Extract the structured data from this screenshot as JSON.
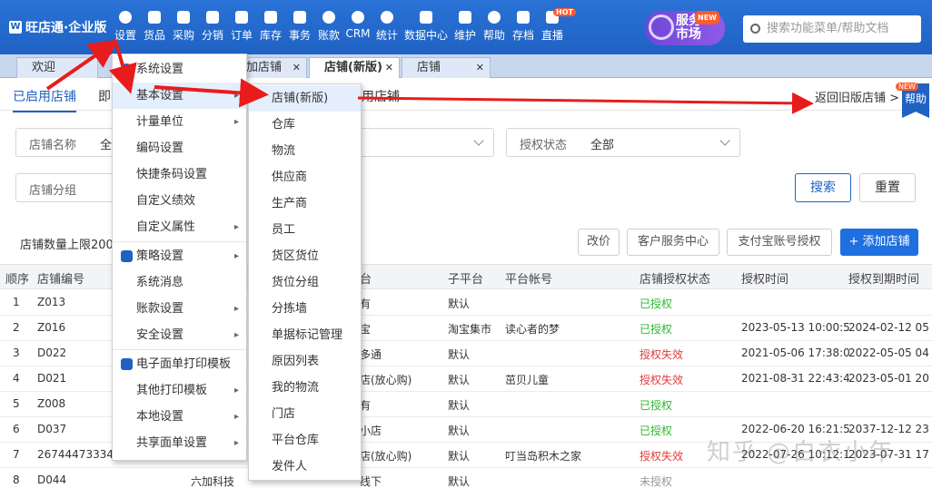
{
  "app": {
    "logo": "旺店通·企业版"
  },
  "nav": [
    {
      "label": "设置"
    },
    {
      "label": "货品"
    },
    {
      "label": "采购"
    },
    {
      "label": "分销"
    },
    {
      "label": "订单"
    },
    {
      "label": "库存"
    },
    {
      "label": "事务"
    },
    {
      "label": "账款"
    },
    {
      "label": "CRM"
    },
    {
      "label": "统计"
    },
    {
      "label": "数据中心"
    },
    {
      "label": "维护"
    },
    {
      "label": "帮助"
    },
    {
      "label": "存档"
    },
    {
      "label": "直播",
      "badge": "HOT"
    }
  ],
  "service_market": {
    "line1": "服务",
    "line2": "市场",
    "badge": "NEW"
  },
  "search": {
    "placeholder": "搜索功能菜单/帮助文档"
  },
  "tabs": [
    {
      "label": "欢迎"
    },
    {
      "label": "加店铺"
    },
    {
      "label": "店铺(新版)"
    },
    {
      "label": "店铺"
    }
  ],
  "subtabs": {
    "enabled": "已启用店铺",
    "partial": "即",
    "disabled_suffix": "用店铺",
    "back": "返回旧版店铺",
    "help": "帮助",
    "help_badge": "NEW"
  },
  "filters": {
    "shop_name_label": "店铺名称",
    "shop_name_value": "全",
    "auth_label": "授权状态",
    "auth_value": "全部",
    "group_label": "店铺分组",
    "search_btn": "搜索",
    "reset_btn": "重置"
  },
  "quota": "店铺数量上限200",
  "actions": {
    "price": "改价",
    "service": "客户服务中心",
    "alipay": "支付宝账号授权",
    "add": "+ 添加店铺"
  },
  "table": {
    "headers": [
      "顺序",
      "店铺编号",
      "台",
      "子平台",
      "平台帐号",
      "店铺授权状态",
      "授权时间",
      "授权到期时间"
    ],
    "rows": [
      {
        "idx": "1",
        "code": "Z013",
        "platform": "有",
        "sub": "默认",
        "account": "",
        "status": "已授权",
        "status_type": "ok",
        "auth_time": "",
        "expire": ""
      },
      {
        "idx": "2",
        "code": "Z016",
        "platform": "宝",
        "sub": "淘宝集市",
        "account": "读心者的梦",
        "status": "已授权",
        "status_type": "ok",
        "auth_time": "2023-05-13 10:00:5",
        "expire": "2024-02-12 05"
      },
      {
        "idx": "3",
        "code": "D022",
        "platform": "多通",
        "sub": "默认",
        "account": "",
        "status": "授权失效",
        "status_type": "fail",
        "auth_time": "2021-05-06 17:38:0",
        "expire": "2022-05-05 04"
      },
      {
        "idx": "4",
        "code": "D021",
        "platform": "店(放心购)",
        "sub": "默认",
        "account": "茁贝儿童",
        "status": "授权失效",
        "status_type": "fail",
        "auth_time": "2021-08-31 22:43:4",
        "expire": "2023-05-01 20"
      },
      {
        "idx": "5",
        "code": "Z008",
        "platform": "有",
        "sub": "默认",
        "account": "",
        "status": "已授权",
        "status_type": "ok",
        "auth_time": "",
        "expire": ""
      },
      {
        "idx": "6",
        "code": "D037",
        "platform": "小店",
        "sub": "默认",
        "account": "",
        "status": "已授权",
        "status_type": "ok",
        "auth_time": "2022-06-20 16:21:5",
        "expire": "2037-12-12 23"
      },
      {
        "idx": "7",
        "code": "267444733347",
        "platform": "店(放心购)",
        "sub": "默认",
        "account": "叮当岛积木之家",
        "status": "授权失效",
        "status_type": "fail",
        "auth_time": "2022-07-26 10:12:1",
        "expire": "2023-07-31 17"
      },
      {
        "idx": "8",
        "code": "D044",
        "shop": "六加科技",
        "platform": "线下",
        "sub": "默认",
        "account": "",
        "status": "未授权",
        "status_type": "none",
        "auth_time": "",
        "expire": ""
      }
    ]
  },
  "settings_menu": [
    {
      "label": "系统设置",
      "icon": "gear",
      "arrow": false
    },
    {
      "label": "基本设置",
      "arrow": true
    },
    {
      "label": "计量单位",
      "arrow": true
    },
    {
      "label": "编码设置",
      "arrow": false
    },
    {
      "label": "快捷条码设置",
      "arrow": false
    },
    {
      "label": "自定义绩效",
      "arrow": false
    },
    {
      "label": "自定义属性",
      "arrow": true
    },
    {
      "label": "策略设置",
      "icon": "layers",
      "arrow": true
    },
    {
      "label": "系统消息",
      "arrow": false
    },
    {
      "label": "账款设置",
      "arrow": true
    },
    {
      "label": "安全设置",
      "arrow": true
    },
    {
      "label": "电子面单打印模板",
      "icon": "printer",
      "arrow": false
    },
    {
      "label": "其他打印模板",
      "arrow": true
    },
    {
      "label": "本地设置",
      "arrow": true
    },
    {
      "label": "共享面单设置",
      "arrow": true
    }
  ],
  "basic_submenu": [
    "店铺(新版)",
    "仓库",
    "物流",
    "供应商",
    "生产商",
    "员工",
    "货区货位",
    "货位分组",
    "分拣墙",
    "单据标记管理",
    "原因列表",
    "我的物流",
    "门店",
    "平台仓库",
    "发件人"
  ],
  "watermark": "知乎 @白衣小年"
}
